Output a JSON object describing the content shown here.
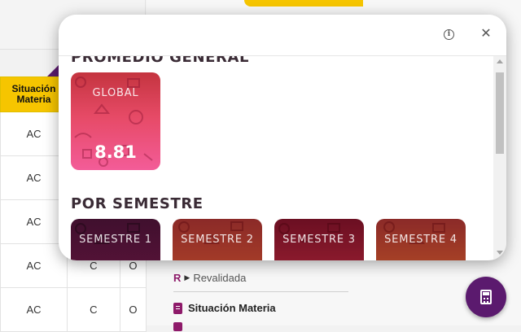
{
  "table": {
    "header": "Situación Materia",
    "rows": [
      [
        "AC",
        "",
        ""
      ],
      [
        "AC",
        "",
        ""
      ],
      [
        "AC",
        "",
        ""
      ],
      [
        "AC",
        "C",
        "O"
      ],
      [
        "AC",
        "C",
        "O"
      ]
    ]
  },
  "legend": {
    "revalidada_code": "R",
    "revalidada_label": "Revalidada",
    "situacion_label": "Situación Materia"
  },
  "modal": {
    "section_general": "PROMEDIO GENERAL",
    "global_label": "GLOBAL",
    "global_value": "8.81",
    "section_semester": "POR SEMESTRE",
    "semesters": [
      "SEMESTRE 1",
      "SEMESTRE 2",
      "SEMESTRE 3",
      "SEMESTRE 4"
    ]
  },
  "icons": {
    "info": "info-icon",
    "close": "close-icon",
    "fab": "calculator-icon"
  },
  "colors": {
    "accent_purple": "#5b1a6e",
    "accent_yellow": "#f6c500",
    "legend_magenta": "#8e1a6a"
  }
}
